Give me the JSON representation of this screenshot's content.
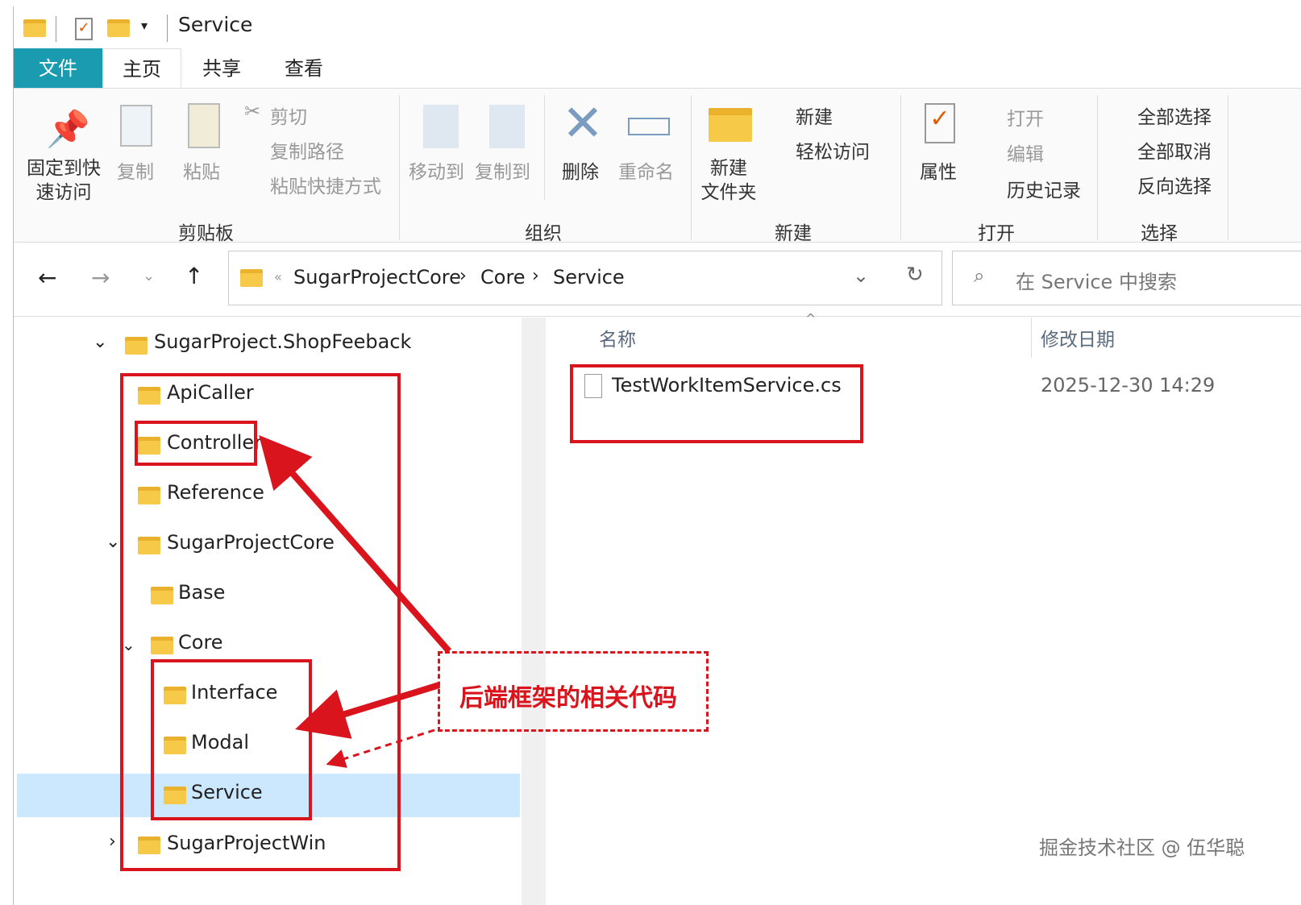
{
  "title": "Service",
  "tabs": [
    "文件",
    "主页",
    "共享",
    "查看"
  ],
  "clip": {
    "pin": "固定到快\n速访问",
    "copy": "复制",
    "paste": "粘贴",
    "cut": "剪切",
    "copypath": "复制路径",
    "pasteshort": "粘贴快捷方式",
    "group": "剪贴板"
  },
  "org": {
    "move": "移动到",
    "copyto": "复制到",
    "del": "删除",
    "rename": "重命名",
    "group": "组织"
  },
  "new": {
    "folder": "新建\n文件夹",
    "item": "新建",
    "easy": "轻松访问",
    "group": "新建"
  },
  "open": {
    "prop": "属性",
    "open": "打开",
    "edit": "编辑",
    "hist": "历史记录",
    "group": "打开"
  },
  "sel": {
    "all": "全部选择",
    "none": "全部取消",
    "inv": "反向选择",
    "group": "选择"
  },
  "crumbs": [
    "SugarProjectCore",
    "Core",
    "Service"
  ],
  "search": "在 Service 中搜索",
  "tree": [
    "SugarProject.ShopFeeback",
    "ApiCaller",
    "Controller",
    "Reference",
    "SugarProjectCore",
    "Base",
    "Core",
    "Interface",
    "Modal",
    "Service",
    "SugarProjectWin"
  ],
  "cols": {
    "name": "名称",
    "date": "修改日期"
  },
  "file": {
    "name": "TestWorkItemService.cs",
    "date": "2025-12-30  14:29"
  },
  "note": "后端框架的相关代码",
  "watermark": "掘金技术社区 @ 伍华聪"
}
